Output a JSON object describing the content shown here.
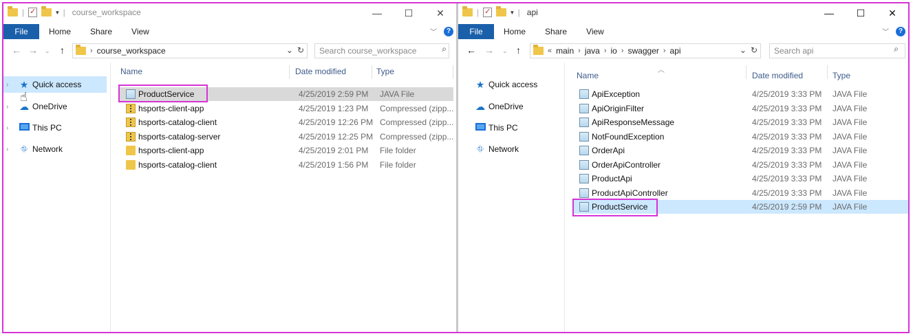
{
  "left": {
    "title": "course_workspace",
    "tabs": {
      "file": "File",
      "home": "Home",
      "share": "Share",
      "view": "View"
    },
    "breadcrumb": [
      "course_workspace"
    ],
    "search_placeholder": "Search course_workspace",
    "nav": [
      "Quick access",
      "OneDrive",
      "This PC",
      "Network"
    ],
    "columns": {
      "name": "Name",
      "date": "Date modified",
      "type": "Type"
    },
    "files": [
      {
        "name": "ProductService",
        "date": "4/25/2019 2:59 PM",
        "type": "JAVA File",
        "icon": "java-file-icon"
      },
      {
        "name": "hsports-client-app",
        "date": "4/25/2019 1:23 PM",
        "type": "Compressed (zipp...",
        "icon": "zip-folder-icon"
      },
      {
        "name": "hsports-catalog-client",
        "date": "4/25/2019 12:26 PM",
        "type": "Compressed (zipp...",
        "icon": "zip-folder-icon"
      },
      {
        "name": "hsports-catalog-server",
        "date": "4/25/2019 12:25 PM",
        "type": "Compressed (zipp...",
        "icon": "zip-folder-icon"
      },
      {
        "name": "hsports-client-app",
        "date": "4/25/2019 2:01 PM",
        "type": "File folder",
        "icon": "folder-icon"
      },
      {
        "name": "hsports-catalog-client",
        "date": "4/25/2019 1:56 PM",
        "type": "File folder",
        "icon": "folder-icon"
      }
    ]
  },
  "right": {
    "title": "api",
    "tabs": {
      "file": "File",
      "home": "Home",
      "share": "Share",
      "view": "View"
    },
    "breadcrumb_prefix": "«",
    "breadcrumb": [
      "main",
      "java",
      "io",
      "swagger",
      "api"
    ],
    "search_placeholder": "Search api",
    "nav": [
      "Quick access",
      "OneDrive",
      "This PC",
      "Network"
    ],
    "columns": {
      "name": "Name",
      "date": "Date modified",
      "type": "Type"
    },
    "files": [
      {
        "name": "ApiException",
        "date": "4/25/2019 3:33 PM",
        "type": "JAVA File",
        "icon": "java-file-icon"
      },
      {
        "name": "ApiOriginFilter",
        "date": "4/25/2019 3:33 PM",
        "type": "JAVA File",
        "icon": "java-file-icon"
      },
      {
        "name": "ApiResponseMessage",
        "date": "4/25/2019 3:33 PM",
        "type": "JAVA File",
        "icon": "java-file-icon"
      },
      {
        "name": "NotFoundException",
        "date": "4/25/2019 3:33 PM",
        "type": "JAVA File",
        "icon": "java-file-icon"
      },
      {
        "name": "OrderApi",
        "date": "4/25/2019 3:33 PM",
        "type": "JAVA File",
        "icon": "java-file-icon"
      },
      {
        "name": "OrderApiController",
        "date": "4/25/2019 3:33 PM",
        "type": "JAVA File",
        "icon": "java-file-icon"
      },
      {
        "name": "ProductApi",
        "date": "4/25/2019 3:33 PM",
        "type": "JAVA File",
        "icon": "java-file-icon"
      },
      {
        "name": "ProductApiController",
        "date": "4/25/2019 3:33 PM",
        "type": "JAVA File",
        "icon": "java-file-icon"
      },
      {
        "name": "ProductService",
        "date": "4/25/2019 2:59 PM",
        "type": "JAVA File",
        "icon": "java-file-icon"
      }
    ]
  },
  "colors": {
    "accent": "#1a5faa",
    "highlight_box": "#d633d6",
    "selection": "#cce8ff",
    "hover": "#d9d9d9"
  }
}
